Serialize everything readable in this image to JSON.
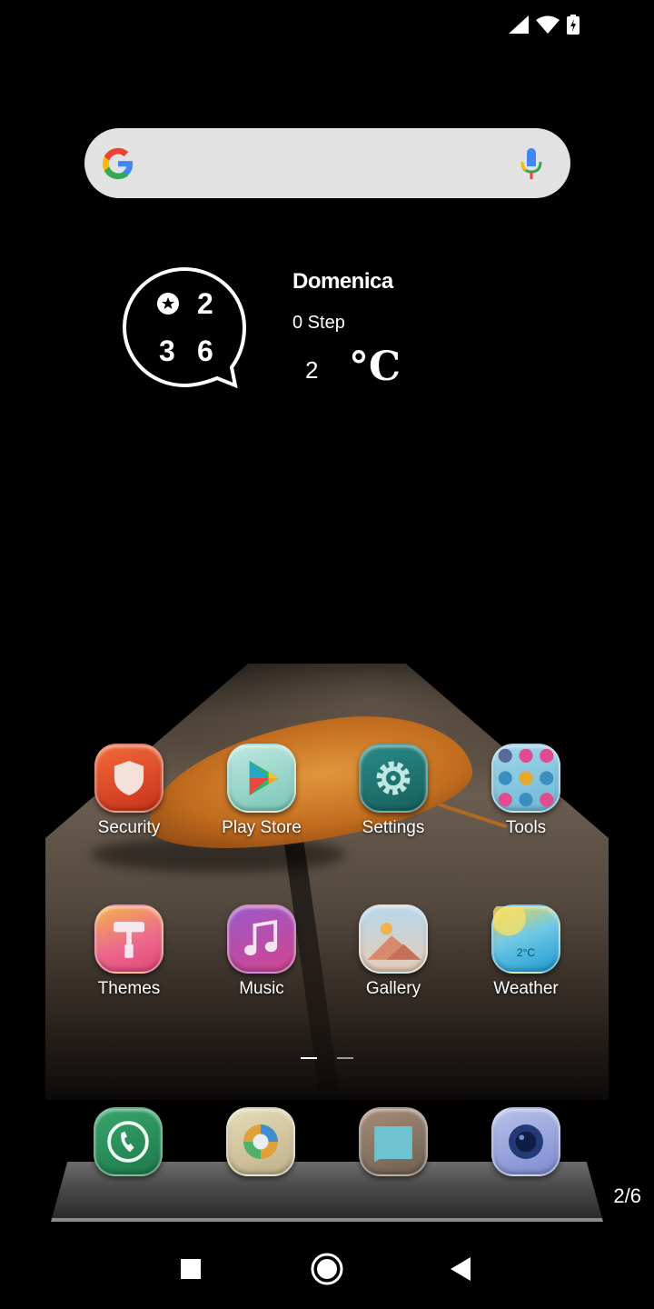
{
  "status_bar": {
    "icons": [
      "signal-icon",
      "wifi-icon",
      "battery-charging-icon"
    ]
  },
  "search": {
    "logo": "google-logo",
    "mic_icon": "mic-icon"
  },
  "widget": {
    "clock_digits": [
      "2",
      "3",
      "6"
    ],
    "day": "Domenica",
    "steps": "0 Step",
    "temperature": "2",
    "unit": "°C"
  },
  "apps": [
    {
      "label": "Security",
      "icon": "shield-icon"
    },
    {
      "label": "Play Store",
      "icon": "play-store-icon"
    },
    {
      "label": "Settings",
      "icon": "gear-icon"
    },
    {
      "label": "Tools",
      "icon": "tools-folder-icon"
    },
    {
      "label": "Themes",
      "icon": "paint-roller-icon"
    },
    {
      "label": "Music",
      "icon": "music-note-icon"
    },
    {
      "label": "Gallery",
      "icon": "gallery-icon"
    },
    {
      "label": "Weather",
      "icon": "weather-icon",
      "badge": "2°C"
    }
  ],
  "page_indicator": {
    "pages": 2,
    "current": 1
  },
  "dock": [
    {
      "name": "Phone",
      "icon": "phone-icon"
    },
    {
      "name": "Browser",
      "icon": "browser-icon"
    },
    {
      "name": "Messages",
      "icon": "messages-icon"
    },
    {
      "name": "Camera",
      "icon": "camera-icon"
    }
  ],
  "page_counter": "2/6",
  "nav": {
    "buttons": [
      "recents-button",
      "home-button",
      "back-button"
    ]
  }
}
